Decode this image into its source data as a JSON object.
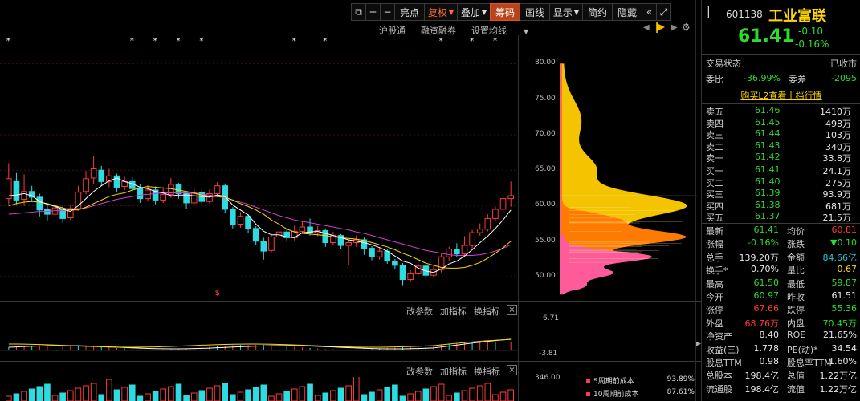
{
  "toolbar": {
    "items": [
      {
        "id": "box",
        "label": "⧉",
        "kind": "icon"
      },
      {
        "id": "plus",
        "label": "+",
        "kind": "icon"
      },
      {
        "id": "minus",
        "label": "−",
        "kind": "icon"
      },
      {
        "id": "liangdian",
        "label": "亮点",
        "kind": "btn"
      },
      {
        "id": "fuquan",
        "label": "复权",
        "kind": "btn",
        "caret": true,
        "style": "hl"
      },
      {
        "id": "diejia",
        "label": "叠加",
        "kind": "btn",
        "caret": true
      },
      {
        "id": "chouma",
        "label": "筹码",
        "kind": "btn",
        "style": "on"
      },
      {
        "id": "huaxian",
        "label": "画线",
        "kind": "btn"
      },
      {
        "id": "xianshi",
        "label": "显示",
        "kind": "btn",
        "caret": true
      },
      {
        "id": "jianyue",
        "label": "简约",
        "kind": "btn"
      },
      {
        "id": "yincang",
        "label": "隐藏",
        "kind": "btn"
      },
      {
        "id": "more",
        "label": "«",
        "kind": "icon"
      },
      {
        "id": "expand",
        "label": "⤢",
        "kind": "icon"
      }
    ]
  },
  "subbar": {
    "hgt": "沪股通",
    "rzrq": "融资融券",
    "ma_settings": "设置均线"
  },
  "markers": {
    "star": "*",
    "dollar": "$"
  },
  "price_axis": [
    "80.00",
    "75.00",
    "70.00",
    "65.00",
    "60.00",
    "55.00",
    "50.00"
  ],
  "panel2": {
    "param": "改参数",
    "add": "加指标",
    "switch": "换指标",
    "close": "×",
    "max": "6.71",
    "min": "-3.81"
  },
  "panel3": {
    "param": "改参数",
    "add": "加指标",
    "switch": "换指标",
    "close": "×",
    "max": "346.00"
  },
  "chip_legend": [
    {
      "label": "5周期前成本",
      "value": "93.89%",
      "color": "#ff3b3b"
    },
    {
      "label": "10周期前成本",
      "value": "87.61%",
      "color": "#ff3b3b"
    }
  ],
  "stock": {
    "code": "601138",
    "name": "工业富联",
    "price": "61.41",
    "change": "-0.10",
    "pct": "-0.16%"
  },
  "status": {
    "label": "交易状态",
    "value": "已收市"
  },
  "weibi": {
    "label": "委比",
    "value": "-36.99%",
    "label2": "委差",
    "value2": "-2095"
  },
  "l2_link": "购买L2查看十档行情",
  "sells": [
    {
      "label": "卖五",
      "price": "61.46",
      "vol": "1410万"
    },
    {
      "label": "卖四",
      "price": "61.45",
      "vol": "498万"
    },
    {
      "label": "卖三",
      "price": "61.44",
      "vol": "103万"
    },
    {
      "label": "卖二",
      "price": "61.43",
      "vol": "340万"
    },
    {
      "label": "卖一",
      "price": "61.42",
      "vol": "33.8万"
    }
  ],
  "buys": [
    {
      "label": "买一",
      "price": "61.41",
      "vol": "24.1万"
    },
    {
      "label": "买二",
      "price": "61.40",
      "vol": "275万"
    },
    {
      "label": "买三",
      "price": "61.39",
      "vol": "93.9万"
    },
    {
      "label": "买四",
      "price": "61.38",
      "vol": "681万"
    },
    {
      "label": "买五",
      "price": "61.37",
      "vol": "21.5万"
    }
  ],
  "stats": [
    {
      "l1": "最新",
      "v1": "61.41",
      "c1": "green",
      "l2": "均价",
      "v2": "60.81",
      "c2": "red"
    },
    {
      "l1": "涨幅",
      "v1": "-0.16%",
      "c1": "green",
      "l2": "涨跌",
      "v2": "▼0.10",
      "c2": "green"
    },
    {
      "l1": "总手",
      "v1": "139.20万",
      "c1": "wht",
      "l2": "金额",
      "v2": "84.66亿",
      "c2": "cyan"
    },
    {
      "l1": "换手*",
      "v1": "0.70%",
      "c1": "wht",
      "l2": "量比",
      "v2": "0.67",
      "c2": "yel"
    },
    {
      "l1": "最高",
      "v1": "61.50",
      "c1": "green",
      "l2": "最低",
      "v2": "59.87",
      "c2": "green"
    },
    {
      "l1": "今开",
      "v1": "60.97",
      "c1": "green",
      "l2": "昨收",
      "v2": "61.51",
      "c2": "wht"
    },
    {
      "l1": "涨停",
      "v1": "67.66",
      "c1": "red",
      "l2": "跌停",
      "v2": "55.36",
      "c2": "green"
    },
    {
      "l1": "外盘",
      "v1": "68.76万",
      "c1": "red",
      "l2": "内盘",
      "v2": "70.45万",
      "c2": "green"
    },
    {
      "l1": "净资产",
      "v1": "8.40",
      "c1": "wht",
      "l2": "ROE",
      "v2": "21.65%",
      "c2": "wht"
    },
    {
      "l1": "收益(三)",
      "v1": "1.778",
      "c1": "wht",
      "l2": "PE(动)*",
      "v2": "34.54",
      "c2": "wht"
    },
    {
      "l1": "股息TTM",
      "v1": "0.98",
      "c1": "wht",
      "l2": "股息率TTM",
      "v2": "1.60%",
      "c2": "wht"
    },
    {
      "l1": "总股本",
      "v1": "198.4亿",
      "c1": "wht",
      "l2": "总值",
      "v2": "1.22万亿",
      "c2": "wht"
    },
    {
      "l1": "流通股",
      "v1": "198.4亿",
      "c1": "wht",
      "l2": "流值",
      "v2": "1.22万亿",
      "c2": "wht"
    }
  ],
  "colors": {
    "up": "#ff3b3b",
    "down": "#2ddbe0",
    "ma5": "#ffffff",
    "ma10": "#ffd800",
    "ma20": "#d040d0",
    "chip_yellow": "#f5c400",
    "chip_orange": "#ff7a00",
    "chip_pink": "#ff5a9a"
  },
  "chart_data": {
    "type": "candlestick",
    "ylim": [
      46.5,
      84.0
    ],
    "count": 66,
    "candles": [
      [
        61.0,
        63.8,
        66.0,
        60.2
      ],
      [
        63.4,
        60.8,
        64.6,
        60.2
      ],
      [
        60.9,
        62.0,
        64.4,
        60.0
      ],
      [
        62.0,
        61.2,
        62.8,
        60.6
      ],
      [
        61.2,
        59.4,
        61.7,
        58.5
      ],
      [
        59.5,
        58.8,
        60.2,
        57.8
      ],
      [
        58.8,
        59.7,
        60.0,
        58.2
      ],
      [
        59.5,
        58.2,
        60.0,
        57.6
      ],
      [
        58.3,
        59.6,
        60.2,
        58.0
      ],
      [
        59.6,
        61.9,
        62.8,
        59.3
      ],
      [
        62.0,
        63.8,
        64.9,
        61.6
      ],
      [
        63.9,
        65.2,
        67.0,
        63.0
      ],
      [
        65.0,
        63.4,
        65.6,
        62.8
      ],
      [
        63.4,
        64.2,
        65.2,
        62.6
      ],
      [
        64.2,
        62.6,
        64.5,
        62.0
      ],
      [
        62.7,
        63.4,
        64.1,
        62.2
      ],
      [
        63.4,
        62.4,
        64.0,
        61.9
      ],
      [
        62.5,
        61.0,
        63.0,
        60.4
      ],
      [
        61.0,
        62.2,
        62.9,
        60.6
      ],
      [
        62.2,
        60.8,
        62.7,
        60.2
      ],
      [
        60.8,
        61.6,
        62.6,
        60.4
      ],
      [
        61.6,
        63.0,
        63.9,
        61.1
      ],
      [
        63.0,
        61.7,
        63.2,
        61.0
      ],
      [
        61.7,
        60.4,
        62.0,
        59.6
      ],
      [
        60.4,
        61.9,
        62.6,
        60.0
      ],
      [
        61.9,
        60.6,
        62.3,
        60.1
      ],
      [
        60.6,
        61.7,
        62.3,
        60.3
      ],
      [
        61.7,
        62.8,
        63.3,
        61.2
      ],
      [
        62.8,
        59.5,
        63.0,
        58.9
      ],
      [
        59.5,
        57.4,
        59.8,
        56.8
      ],
      [
        57.4,
        58.5,
        59.1,
        56.9
      ],
      [
        58.5,
        56.8,
        58.8,
        56.2
      ],
      [
        56.8,
        55.0,
        57.1,
        54.5
      ],
      [
        55.0,
        53.6,
        55.5,
        52.4
      ],
      [
        53.7,
        55.6,
        56.0,
        53.4
      ],
      [
        55.6,
        56.3,
        57.4,
        55.2
      ],
      [
        56.3,
        55.5,
        56.8,
        55.0
      ],
      [
        55.5,
        56.4,
        57.2,
        55.1
      ],
      [
        56.4,
        57.0,
        57.9,
        56.1
      ],
      [
        57.0,
        56.2,
        58.2,
        55.8
      ],
      [
        56.2,
        56.5,
        57.1,
        55.7
      ],
      [
        56.5,
        54.8,
        56.8,
        54.2
      ],
      [
        54.8,
        55.8,
        56.3,
        54.5
      ],
      [
        55.8,
        54.4,
        56.0,
        53.9
      ],
      [
        54.4,
        54.8,
        55.2,
        51.7
      ],
      [
        54.8,
        55.2,
        55.8,
        54.2
      ],
      [
        55.2,
        54.0,
        55.5,
        53.1
      ],
      [
        54.0,
        52.8,
        54.3,
        52.3
      ],
      [
        52.8,
        53.6,
        54.1,
        52.4
      ],
      [
        53.6,
        52.2,
        53.9,
        51.8
      ],
      [
        52.2,
        51.6,
        52.5,
        51.0
      ],
      [
        51.6,
        49.6,
        51.9,
        48.8
      ],
      [
        49.6,
        50.4,
        50.9,
        49.3
      ],
      [
        50.4,
        51.5,
        51.9,
        50.2
      ],
      [
        51.5,
        50.2,
        51.8,
        49.7
      ],
      [
        50.2,
        51.0,
        51.5,
        49.9
      ],
      [
        51.0,
        52.8,
        53.4,
        50.6
      ],
      [
        52.8,
        53.9,
        54.2,
        52.3
      ],
      [
        53.9,
        53.2,
        54.7,
        52.8
      ],
      [
        53.2,
        54.4,
        55.7,
        52.9
      ],
      [
        54.4,
        56.2,
        56.6,
        54.0
      ],
      [
        56.2,
        56.7,
        57.5,
        55.8
      ],
      [
        56.7,
        58.2,
        58.8,
        56.4
      ],
      [
        58.2,
        59.5,
        59.9,
        57.8
      ],
      [
        59.5,
        61.0,
        61.5,
        58.9
      ],
      [
        61.0,
        61.41,
        63.4,
        59.87
      ]
    ],
    "ma5": [
      61.4,
      61.5,
      61.7,
      61.4,
      60.6,
      60.2,
      59.9,
      59.5,
      59.2,
      60.0,
      61.0,
      62.0,
      62.8,
      63.5,
      63.9,
      63.4,
      63.1,
      62.6,
      62.4,
      62.0,
      61.8,
      61.4,
      61.5,
      61.5,
      61.4,
      61.3,
      61.2,
      61.5,
      61.3,
      60.1,
      59.4,
      58.7,
      57.4,
      56.4,
      55.9,
      55.9,
      55.6,
      55.5,
      56.2,
      56.3,
      56.4,
      56.1,
      55.8,
      55.5,
      55.2,
      55.0,
      54.8,
      54.5,
      54.1,
      53.6,
      52.9,
      52.2,
      51.9,
      51.2,
      50.8,
      50.6,
      51.1,
      51.8,
      52.2,
      52.9,
      53.8,
      54.8,
      55.7,
      56.8,
      58.0,
      59.4
    ],
    "ma10": [
      60.0,
      60.3,
      60.5,
      60.6,
      60.5,
      60.3,
      60.0,
      59.7,
      59.4,
      59.4,
      59.8,
      60.3,
      60.8,
      61.3,
      61.6,
      61.8,
      62.2,
      62.5,
      62.7,
      62.6,
      62.5,
      62.4,
      62.2,
      62.0,
      61.8,
      61.5,
      61.3,
      61.3,
      61.2,
      60.8,
      60.3,
      59.9,
      59.4,
      58.8,
      58.0,
      57.4,
      56.7,
      56.3,
      56.1,
      56.0,
      55.9,
      55.8,
      55.6,
      55.5,
      55.4,
      55.3,
      55.1,
      54.8,
      54.5,
      54.2,
      53.8,
      53.3,
      52.9,
      52.4,
      51.9,
      51.6,
      51.3,
      51.2,
      51.2,
      51.3,
      51.6,
      52.0,
      52.6,
      53.3,
      54.1,
      55.0
    ],
    "ma20": [
      58.8,
      58.9,
      59.0,
      59.1,
      59.2,
      59.2,
      59.3,
      59.3,
      59.4,
      59.5,
      59.7,
      60.0,
      60.3,
      60.6,
      60.9,
      61.1,
      61.3,
      61.5,
      61.6,
      61.7,
      61.8,
      61.8,
      61.8,
      61.8,
      61.7,
      61.6,
      61.5,
      61.3,
      61.1,
      60.8,
      60.5,
      60.2,
      59.8,
      59.4,
      59.0,
      58.6,
      58.3,
      58.0,
      57.8,
      57.6,
      57.4,
      57.2,
      57.0,
      56.8,
      56.6,
      56.3,
      56.1,
      55.8,
      55.5,
      55.2,
      54.9,
      54.6,
      54.3,
      54.0,
      53.7,
      53.5,
      53.3,
      53.1,
      53.0,
      53.0,
      53.0,
      53.1,
      53.3,
      53.6,
      54.0,
      54.5
    ],
    "star_columns": [
      0,
      16,
      19,
      22,
      25,
      37,
      41,
      56,
      60,
      63
    ],
    "dollar_column": 27
  }
}
